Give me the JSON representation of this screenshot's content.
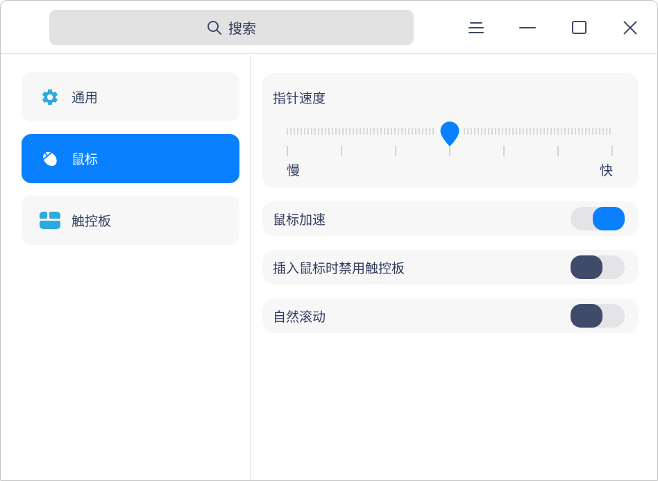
{
  "titlebar": {
    "search_placeholder": "搜索"
  },
  "sidebar": {
    "items": [
      {
        "label": "通用",
        "icon": "gear-icon",
        "selected": false
      },
      {
        "label": "鼠标",
        "icon": "mouse-icon",
        "selected": true
      },
      {
        "label": "触控板",
        "icon": "touchpad-icon",
        "selected": false
      }
    ]
  },
  "main": {
    "pointer_speed": {
      "title": "指针速度",
      "slow_label": "慢",
      "fast_label": "快",
      "tick_count": 7,
      "value_percent": 50
    },
    "toggles": [
      {
        "label": "鼠标加速",
        "on": true
      },
      {
        "label": "插入鼠标时禁用触控板",
        "on": false
      },
      {
        "label": "自然滚动",
        "on": false
      }
    ]
  },
  "colors": {
    "accent": "#0981ff",
    "icon_cyan": "#2caadf",
    "text": "#313d5d",
    "card_bg": "#f7f7f8",
    "toggle_track": "#e4e4e6",
    "toggle_off_thumb": "#3f4b69",
    "search_bg": "#e2e2e3"
  }
}
